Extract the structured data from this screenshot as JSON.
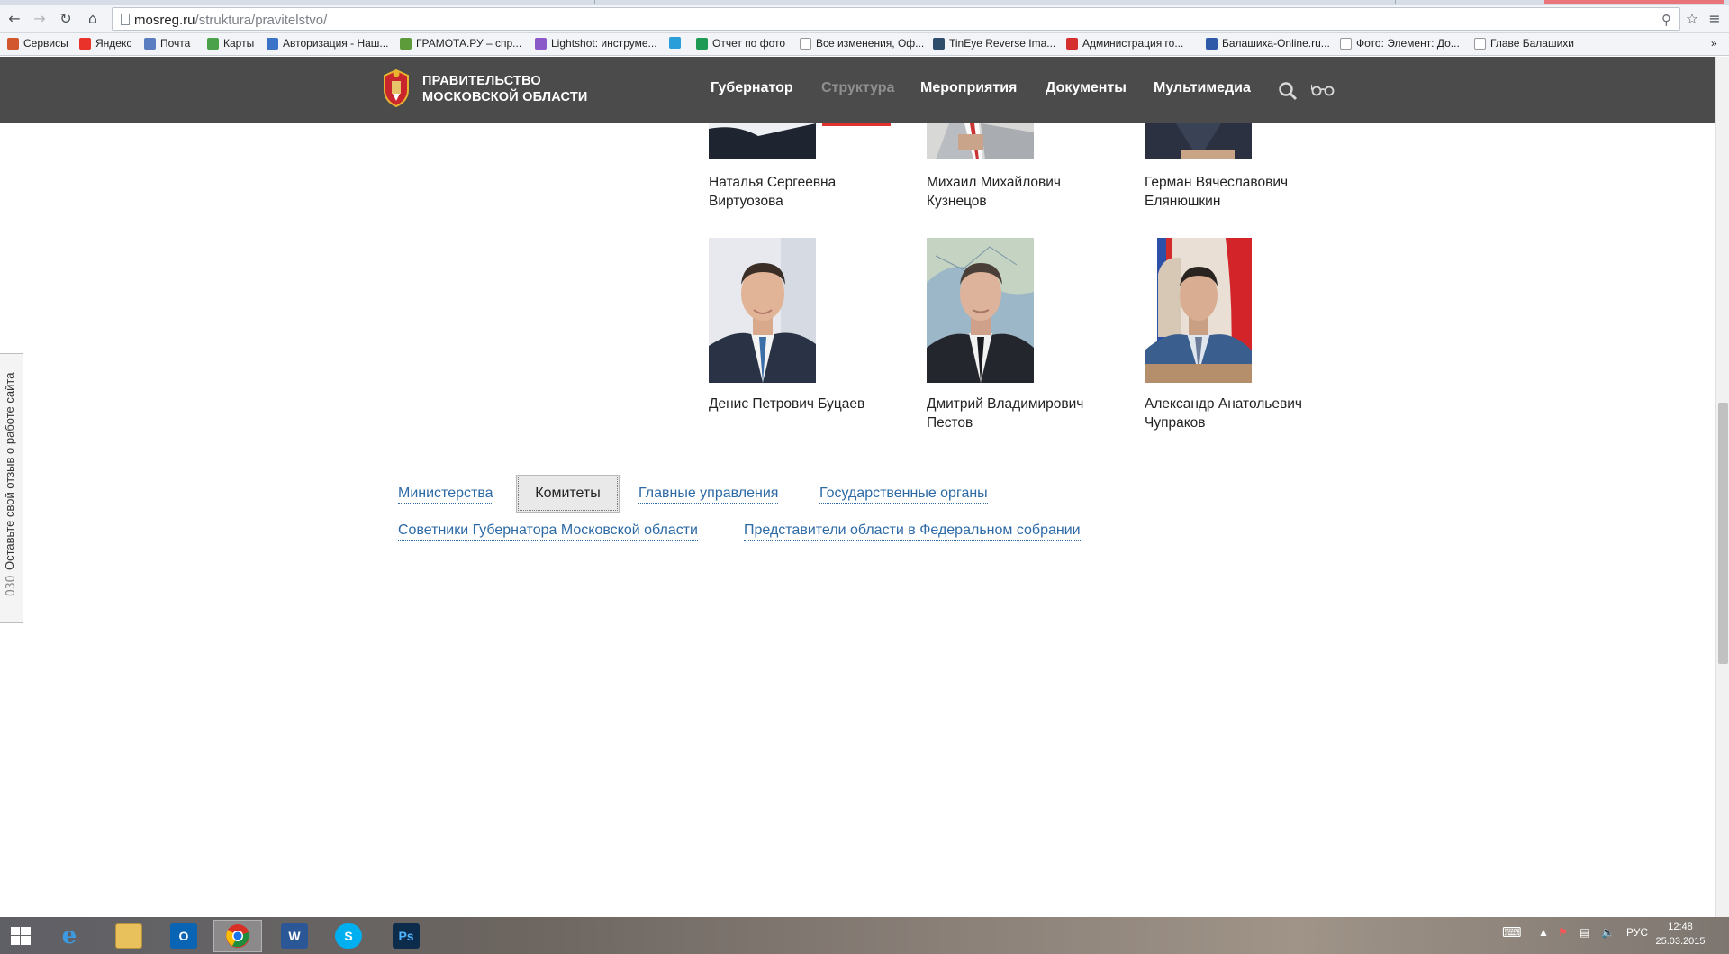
{
  "browser": {
    "url_host": "mosreg.ru",
    "url_path": "/struktura/pravitelstvo/",
    "bookmarks": [
      {
        "label": "Сервисы",
        "color": "#d2572e"
      },
      {
        "label": "Яндекс",
        "color": "#e8322a"
      },
      {
        "label": "Почта",
        "color": "#5a7cc0"
      },
      {
        "label": "Карты",
        "color": "#4aa24a"
      },
      {
        "label": "Авторизация - Наш...",
        "color": "#3b73c8"
      },
      {
        "label": "ГРАМОТА.РУ – спр...",
        "color": "#5d9a3a"
      },
      {
        "label": "Lightshot: инструме...",
        "color": "#8a58c8"
      },
      {
        "label": "",
        "color": "#2a9ed8"
      },
      {
        "label": "Отчет по фото",
        "color": "#1f9a54"
      },
      {
        "label": "Все изменения, Оф...",
        "color": "#ffffff"
      },
      {
        "label": "TinEye Reverse Ima...",
        "color": "#2d4d6a"
      },
      {
        "label": "Администрация го...",
        "color": "#d42e2e"
      },
      {
        "label": "Балашиха-Online.ru...",
        "color": "#2e5aa8"
      },
      {
        "label": "Фото: Элемент: До...",
        "color": "#ffffff"
      },
      {
        "label": "Главе Балашихи",
        "color": "#ffffff"
      }
    ]
  },
  "site": {
    "logo_line1": "ПРАВИТЕЛЬСТВО",
    "logo_line2": "МОСКОВСКОЙ ОБЛАСТИ",
    "nav": [
      "Губернатор",
      "Структура",
      "Мероприятия",
      "Документы",
      "Мультимедиа"
    ],
    "active_nav": "Структура"
  },
  "people_top": [
    {
      "first": "Наталья Сергеевна",
      "last": "Виртуозова"
    },
    {
      "first": "Михаил Михайлович",
      "last": "Кузнецов"
    },
    {
      "first": "Герман Вячеславович",
      "last": "Елянюшкин"
    }
  ],
  "people_bottom": [
    {
      "first": "Денис Петрович Буцаев",
      "last": ""
    },
    {
      "first": "Дмитрий Владимирович",
      "last": "Пестов"
    },
    {
      "first": "Александр Анатольевич",
      "last": "Чупраков"
    }
  ],
  "categories": {
    "row1": [
      "Министерства",
      "Комитеты",
      "Главные управления",
      "Государственные органы"
    ],
    "row2": [
      "Советники Губернатора Московской области",
      "Представители области в Федеральном собрании"
    ],
    "active": "Комитеты"
  },
  "feedback": {
    "text": "Оставьте свой отзыв о работе сайта",
    "brand": "ОЗО"
  },
  "taskbar": {
    "lang": "РУС",
    "time": "12:48",
    "date": "25.03.2015"
  }
}
